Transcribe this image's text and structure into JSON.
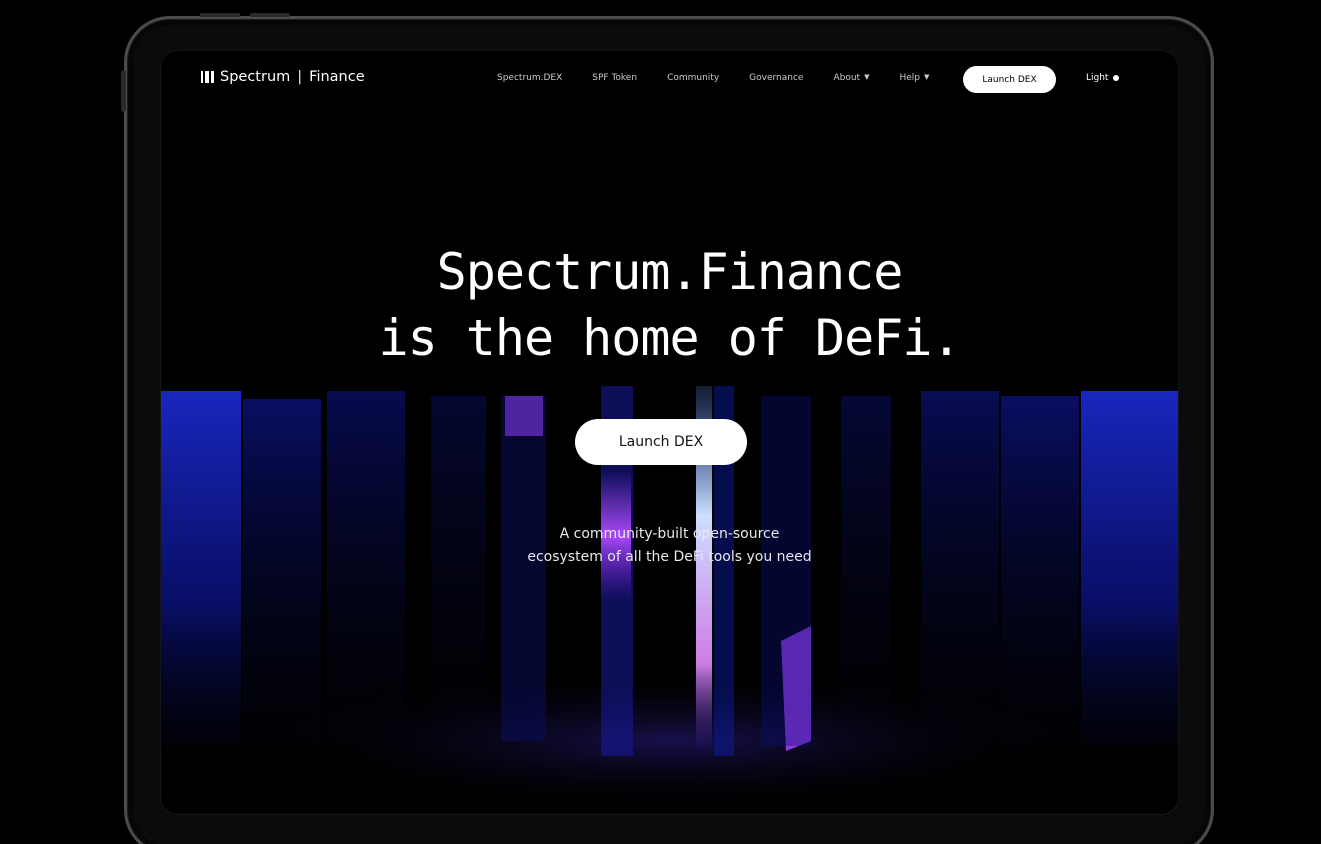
{
  "nav": {
    "brand_name": "Spectrum",
    "brand_suffix": "Finance",
    "links": [
      {
        "label": "Spectrum.DEX"
      },
      {
        "label": "SPF Token"
      },
      {
        "label": "Community"
      },
      {
        "label": "Governance"
      },
      {
        "label": "About",
        "dropdown": true
      },
      {
        "label": "Help",
        "dropdown": true
      }
    ],
    "cta_label": "Launch DEX",
    "theme_label": "Light"
  },
  "hero": {
    "title_line1": "Spectrum.Finance",
    "title_line2": "is the home of DeFi.",
    "subtitle_line1": "A community-built open-source",
    "subtitle_line2": "ecosystem of all the DeFi tools you need",
    "cta_label": "Launch DEX"
  },
  "colors": {
    "background": "#000000",
    "accent_blue": "#1a2fd6",
    "accent_purple": "#9b3cff",
    "accent_light_blue": "#6ea8ff"
  },
  "icons": {
    "logo": "spectrum-logo-icon",
    "dropdown": "chevron-down-icon",
    "theme": "theme-dot-icon"
  }
}
